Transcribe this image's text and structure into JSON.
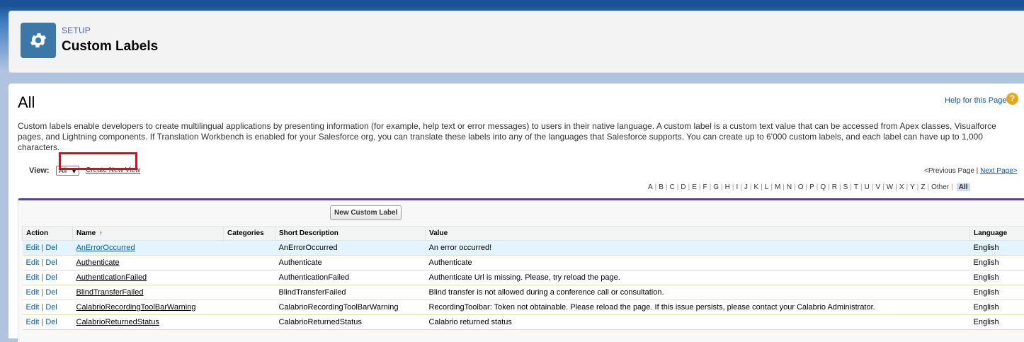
{
  "header": {
    "breadcrumb": "SETUP",
    "title": "Custom Labels",
    "icon": "gear-icon"
  },
  "main": {
    "heading": "All",
    "help_link": "Help for this Page",
    "help_icon": "?",
    "description": "Custom labels enable developers to create multilingual applications by presenting information (for example, help text or error messages) to users in their native language. A custom label is a custom text value that can be accessed from Apex classes, Visualforce pages, and Lightning components. If Translation Workbench is enabled for your Salesforce org, you can translate these labels into any of the languages that Salesforce supports. You can create up to 6'000 custom labels, and each label can have up to 1,000 characters."
  },
  "view": {
    "label": "View:",
    "selected": "All",
    "create_link": "Create New View"
  },
  "paging": {
    "prev": "<Previous Page",
    "separator": "|",
    "next": "Next Page>"
  },
  "alphabet": [
    "A",
    "B",
    "C",
    "D",
    "E",
    "F",
    "G",
    "H",
    "I",
    "J",
    "K",
    "L",
    "M",
    "N",
    "O",
    "P",
    "Q",
    "R",
    "S",
    "T",
    "U",
    "V",
    "W",
    "X",
    "Y",
    "Z",
    "Other"
  ],
  "alphabet_active": "All",
  "list": {
    "new_button": "New Custom Label",
    "columns": {
      "action": "Action",
      "name": "Name",
      "sort_indicator": "↑",
      "categories": "Categories",
      "short_description": "Short Description",
      "value": "Value",
      "language": "Language"
    },
    "edit_label": "Edit",
    "del_label": "Del",
    "action_sep": "|",
    "rows": [
      {
        "name": "AnErrorOccurred",
        "categories": "",
        "short_description": "AnErrorOccurred",
        "value": "An error occurred!",
        "language": "English"
      },
      {
        "name": "Authenticate",
        "categories": "",
        "short_description": "Authenticate",
        "value": "Authenticate",
        "language": "English"
      },
      {
        "name": "AuthenticationFailed",
        "categories": "",
        "short_description": "AuthenticationFailed",
        "value": "Authenticate Url is missing. Please, try reload the page.",
        "language": "English"
      },
      {
        "name": "BlindTransferFailed",
        "categories": "",
        "short_description": "BlindTransferFailed",
        "value": "Blind transfer is not allowed during a conference call or consultation.",
        "language": "English"
      },
      {
        "name": "CalabrioRecordingToolBarWarning",
        "categories": "",
        "short_description": "CalabrioRecordingToolBarWarning",
        "value": "RecordingToolbar: Token not obtainable. Please reload the page. If this issue persists, please contact your Calabrio Administrator.",
        "language": "English"
      },
      {
        "name": "CalabrioReturnedStatus",
        "categories": "",
        "short_description": "CalabrioReturnedStatus",
        "value": "Calabrio returned status",
        "language": "English"
      }
    ]
  },
  "colors": {
    "brand_blue": "#1b5297",
    "header_icon_bg": "#3b78a8",
    "link_blue": "#015ba7",
    "list_accent": "#56458c",
    "highlight_row": "#e3f3ff",
    "annotation_red": "#e30613"
  }
}
